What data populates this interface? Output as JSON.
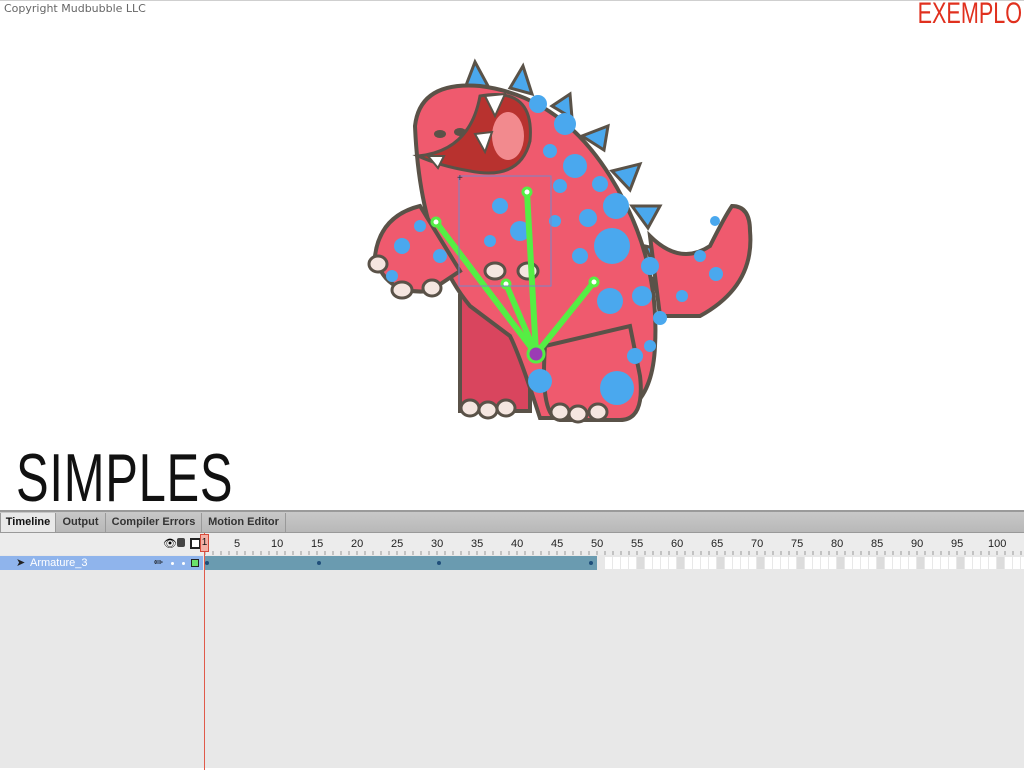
{
  "stage": {
    "copyright": "Copyright Mudbubble LLC",
    "label": "EXEMPLO",
    "title": "SIMPLES"
  },
  "timeline": {
    "tabs": [
      "Timeline",
      "Output",
      "Compiler Errors",
      "Motion Editor"
    ],
    "active_tab": "Timeline",
    "current_frame": "1",
    "frame_numbers": [
      "5",
      "10",
      "15",
      "20",
      "25",
      "30",
      "35",
      "40",
      "45",
      "50",
      "55",
      "60",
      "65",
      "70",
      "75",
      "80",
      "85",
      "90",
      "95",
      "100"
    ],
    "layers": [
      {
        "name": "Armature_3",
        "span_end_frame": 49,
        "keyframes": [
          1,
          15,
          30,
          49
        ]
      }
    ]
  },
  "colors": {
    "accent_red": "#e0301e",
    "layer_selected": "#8fb4ec",
    "pose_span": "#6a9bb0",
    "bones": "#55ee44",
    "monster_body": "#ef5a6e",
    "spots": "#4aa8ee"
  },
  "icons": [
    "eye-icon",
    "lock-icon",
    "outline-icon",
    "armature-icon",
    "pencil-icon"
  ]
}
